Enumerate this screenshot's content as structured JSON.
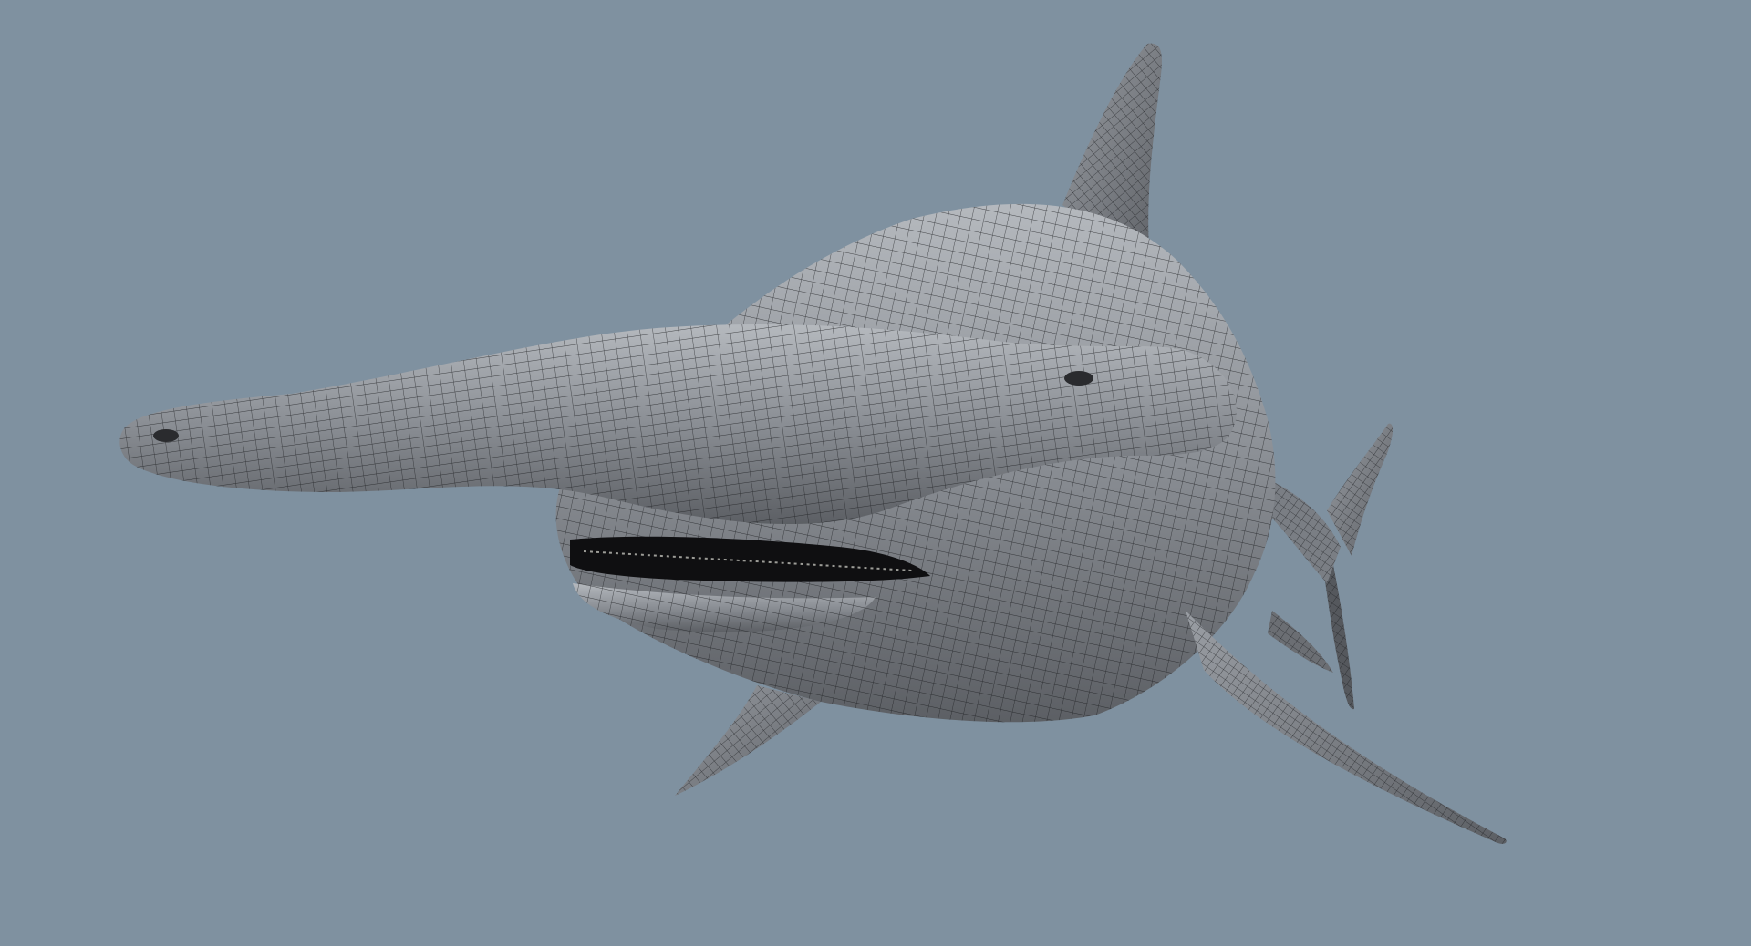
{
  "viewport": {
    "background_color": "#7f91a0",
    "subject": "hammerhead-shark-wireframe",
    "mesh": {
      "surface_color": "#8a8e94",
      "surface_highlight": "#b5b9be",
      "surface_shadow": "#5c5f64",
      "wire_color": "#1c1d20",
      "mouth_color": "#0f0f11",
      "tooth_color": "#d8d8d0"
    }
  }
}
